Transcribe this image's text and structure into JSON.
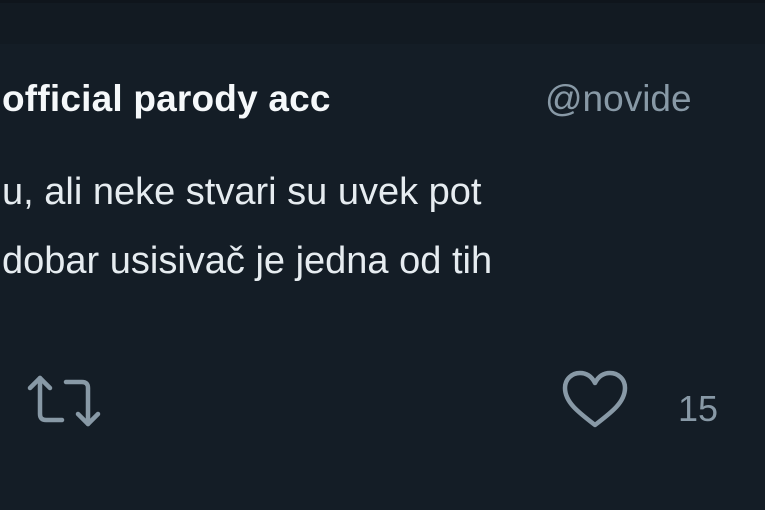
{
  "tweet": {
    "display_name": "official parody acc",
    "handle": "@novide",
    "text_lines": [
      "u, ali neke stvari su uvek pot",
      "dobar usisivač je jedna od tih"
    ],
    "actions": {
      "retweet_icon": "retweet-icon",
      "like_icon": "heart-icon",
      "like_count": "15"
    },
    "colors": {
      "background": "#141d26",
      "text": "#e6ecf0",
      "muted": "#8899a6"
    }
  }
}
